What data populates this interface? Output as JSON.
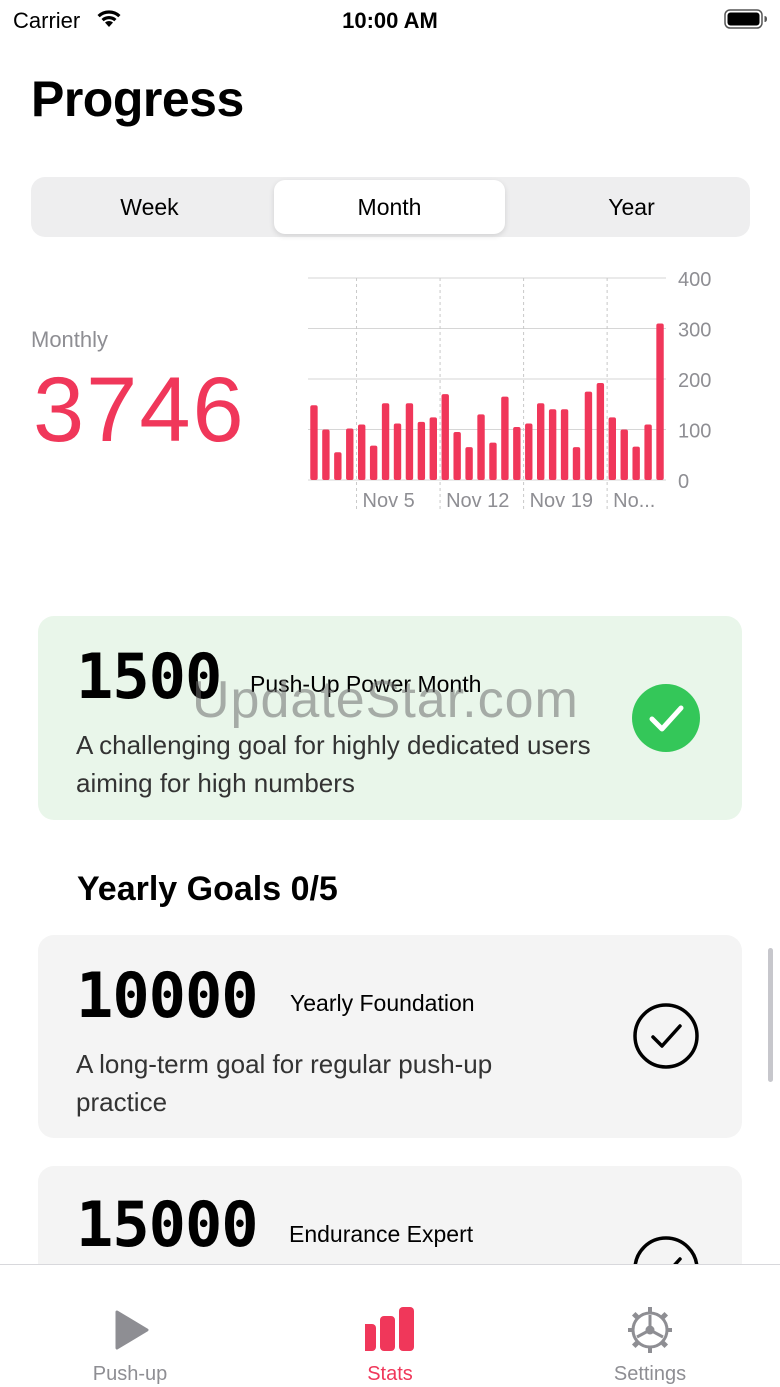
{
  "status_bar": {
    "carrier": "Carrier",
    "time": "10:00 AM"
  },
  "page_title": "Progress",
  "segments": {
    "items": [
      "Week",
      "Month",
      "Year"
    ],
    "selected": "Month"
  },
  "summary": {
    "label": "Monthly",
    "value": "3746"
  },
  "chart_data": {
    "type": "bar",
    "x_tick_labels": [
      "Nov 5",
      "Nov 12",
      "Nov 19",
      "No..."
    ],
    "y_ticks": [
      0,
      100,
      200,
      300,
      400
    ],
    "ylim": [
      0,
      400
    ],
    "y_axis_position": "right",
    "grid": true,
    "bar_color": "#f0375a",
    "values": [
      148,
      100,
      55,
      102,
      110,
      68,
      152,
      112,
      152,
      115,
      124,
      170,
      95,
      65,
      130,
      74,
      165,
      105,
      112,
      152,
      140,
      140,
      65,
      175,
      192,
      124,
      100,
      66,
      110,
      310
    ]
  },
  "monthly_goal": {
    "number": "1500",
    "name": "Push-Up Power Month",
    "description": "A challenging goal for highly dedicated users aiming for high numbers",
    "status_icon": "checkmark-filled-circle",
    "status_color": "#34c759"
  },
  "yearly_section": {
    "title": "Yearly Goals 0/5"
  },
  "yearly_goals": [
    {
      "number": "10000",
      "name": "Yearly Foundation",
      "description": "A long-term goal for regular push-up practice",
      "status_icon": "checkmark-outline-circle"
    },
    {
      "number": "15000",
      "name": "Endurance Expert",
      "status_icon": "checkmark-outline-circle"
    }
  ],
  "watermark": "UpdateStar.com",
  "tab_bar": {
    "items": [
      {
        "label": "Push-up",
        "icon": "play-icon"
      },
      {
        "label": "Stats",
        "icon": "bar-chart-icon"
      },
      {
        "label": "Settings",
        "icon": "gear-icon"
      }
    ],
    "selected": "Stats",
    "active_color": "#f0375a"
  }
}
